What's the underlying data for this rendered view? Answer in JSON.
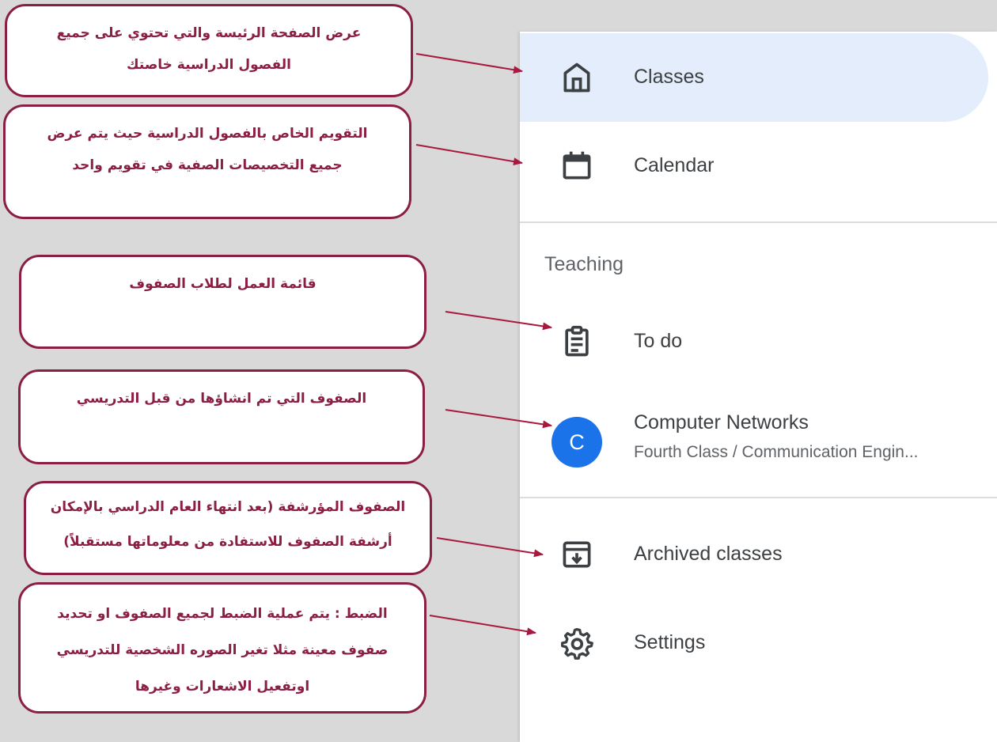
{
  "sidebar": {
    "items": {
      "classes": {
        "label": "Classes",
        "icon": "home-icon",
        "active": true
      },
      "calendar": {
        "label": "Calendar",
        "icon": "calendar-icon"
      },
      "todo": {
        "label": "To do",
        "icon": "clipboard-icon"
      },
      "archived": {
        "label": "Archived classes",
        "icon": "archive-icon"
      },
      "settings": {
        "label": "Settings",
        "icon": "gear-icon"
      }
    },
    "teaching": {
      "heading": "Teaching",
      "class": {
        "avatar_letter": "C",
        "title": "Computer Networks",
        "subtitle": "Fourth Class / Communication Engin..."
      }
    }
  },
  "annotations": {
    "classes": {
      "line1": "عرض الصفحة الرئيسة والتي تحتوي على جميع",
      "line2": "الفصول الدراسية خاصتك"
    },
    "calendar": {
      "line1": "التقويم الخاص بالفصول الدراسية حيث يتم عرض",
      "line2": "جميع التخصيصات الصفية في تقويم واحد"
    },
    "todo": {
      "line1": "قائمة العمل لطلاب الصفوف"
    },
    "classes_created": {
      "line1": "الصفوف التي تم انشاؤها من قبل التدريسي"
    },
    "archived": {
      "line1": "الصفوف المؤرشفة (بعد انتهاء العام الدراسي بالإمكان",
      "line2": "أرشفة الصفوف للاستفادة من معلوماتها مستقبلاً)"
    },
    "settings": {
      "line1": "الضبط : يتم عملية الضبط لجميع الصفوف او تحديد",
      "line2": "صفوف معينة مثلا تغير الصوره الشخصية للتدريسي",
      "line3": "اوتفعيل الاشعارات وغيرها"
    }
  },
  "colors": {
    "background": "#d9d9d9",
    "active_highlight": "#e3edfb",
    "callout_accent": "#8b1e44",
    "avatar": "#1a73e8"
  }
}
